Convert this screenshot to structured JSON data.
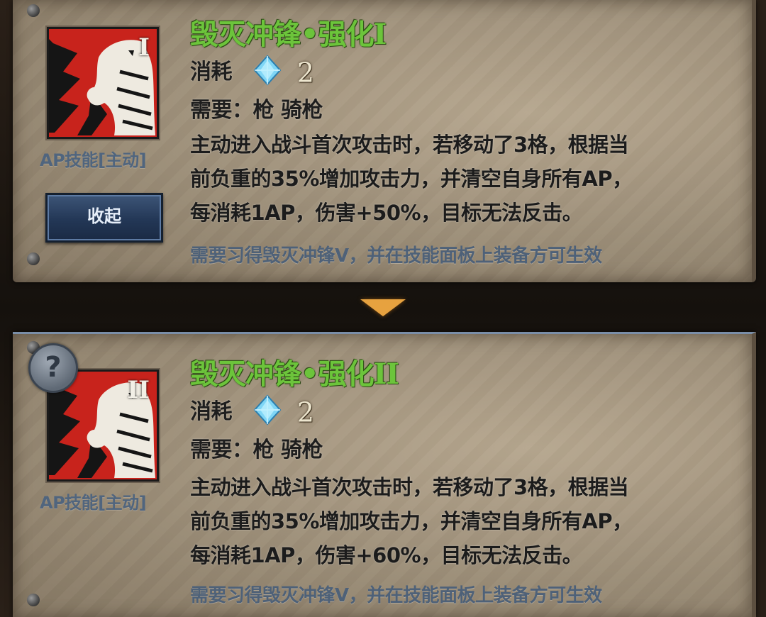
{
  "panels": [
    {
      "title": "毁灭冲锋•强化I",
      "roman": "I",
      "cost_label": "消耗",
      "cost_value": "2",
      "requirement": "需要：枪  骑枪",
      "description": [
        "主动进入战斗首次攻击时，若移动了3格，根据当",
        "前负重的35%增加攻击力，并清空自身所有AP，",
        "每消耗1AP，伤害+50%，目标无法反击。"
      ],
      "icon_caption": "AP技能[主动]",
      "note": "需要习得毁灭冲锋V，并在技能面板上装备方可生效",
      "button_label": "收起"
    },
    {
      "title": "毁灭冲锋•强化II",
      "roman": "II",
      "cost_label": "消耗",
      "cost_value": "2",
      "requirement": "需要：枪  骑枪",
      "description": [
        "主动进入战斗首次攻击时，若移动了3格，根据当",
        "前负重的35%增加攻击力，并清空自身所有AP，",
        "每消耗1AP，伤害+60%，目标无法反击。"
      ],
      "icon_caption": "AP技能[主动]",
      "note": "需要习得毁灭冲锋V，并在技能面板上装备方可生效",
      "help_symbol": "?"
    }
  ],
  "colors": {
    "title_green": "#6cc43b",
    "note_blue": "#4e6178",
    "icon_red": "#c8231c",
    "arrow_orange": "#e7a23f"
  },
  "icons": [
    "crystal-icon",
    "horse-skill-icon",
    "help-icon",
    "down-arrow-icon"
  ]
}
